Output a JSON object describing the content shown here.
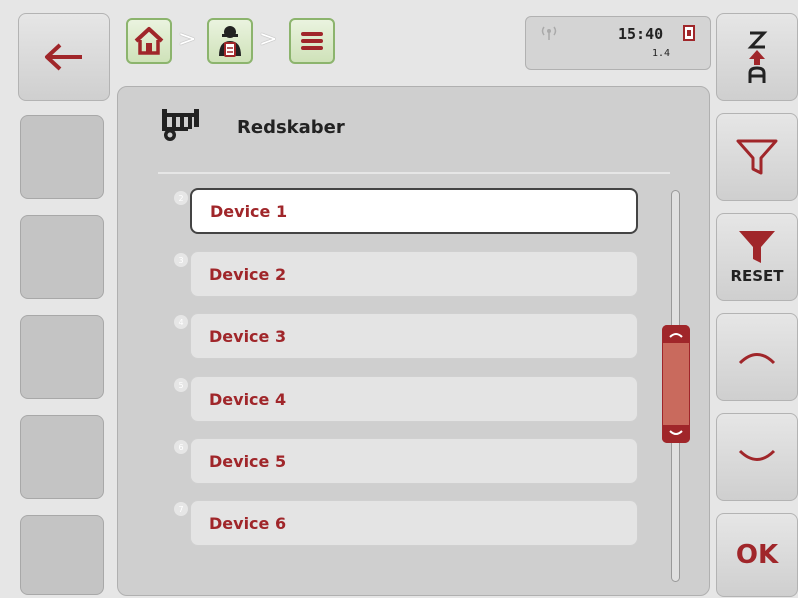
{
  "status": {
    "time": "15:40",
    "version": "1.4"
  },
  "header": {
    "title": "Redskaber"
  },
  "list": {
    "items": [
      {
        "index": "2",
        "label": "Device 1",
        "selected": true
      },
      {
        "index": "3",
        "label": "Device 2",
        "selected": false
      },
      {
        "index": "4",
        "label": "Device 3",
        "selected": false
      },
      {
        "index": "5",
        "label": "Device 4",
        "selected": false
      },
      {
        "index": "6",
        "label": "Device 5",
        "selected": false
      },
      {
        "index": "7",
        "label": "Device 6",
        "selected": false
      }
    ]
  },
  "right_bar": {
    "sort_top": "Z",
    "sort_bottom": "A",
    "reset_label": "RESET",
    "ok_label": "OK"
  },
  "colors": {
    "accent_red": "#a0262a",
    "crumb_green": "#8cb46d",
    "scroll_thumb": "#c96a5d"
  },
  "icons": [
    "back-arrow-icon",
    "home-icon",
    "operator-icon",
    "menu-icon",
    "antenna-icon",
    "sim-card-icon",
    "implement-icon",
    "sort-icon",
    "filter-icon",
    "filter-reset-icon",
    "chevron-up-icon",
    "chevron-down-icon"
  ]
}
